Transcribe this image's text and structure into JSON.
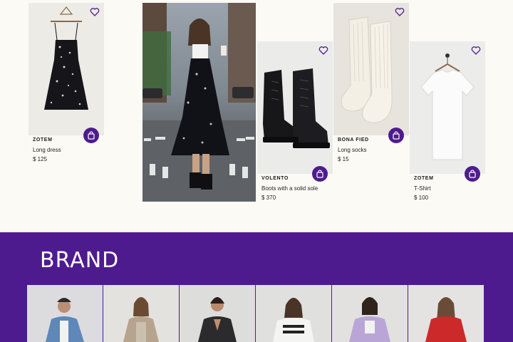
{
  "products": [
    {
      "brand": "ZOTEM",
      "name": "Long dress",
      "price": "$ 125",
      "image": "black floral slip dress on hanger"
    },
    {
      "brand": "",
      "name": "",
      "price": "",
      "image": "woman in black floral dress crossing city street"
    },
    {
      "brand": "VOLENTO",
      "name": "Boots with a solid sole",
      "price": "$ 370",
      "image": "black leather lace-up boots"
    },
    {
      "brand": "BONA FIED",
      "name": "Long socks",
      "price": "$ 15",
      "image": "cream ribbed long socks"
    },
    {
      "brand": "ZOTEM",
      "name": "T-Shirt",
      "price": "$ 100",
      "image": "white t-shirt on wooden hanger"
    }
  ],
  "icons": {
    "favorite": "heart-outline-icon",
    "add_to_bag": "shopping-bag-icon"
  },
  "brand_section": {
    "title": "BRAND",
    "tiles": [
      "model in denim jacket and cap",
      "model in beige cardigan",
      "model in black blazer",
      "model in slogan t-shirt",
      "model in lavender jacket",
      "model in red sweater"
    ]
  },
  "colors": {
    "accent": "#4e1b8f",
    "background": "#fbfaf5",
    "text": "#1f1f1f"
  }
}
